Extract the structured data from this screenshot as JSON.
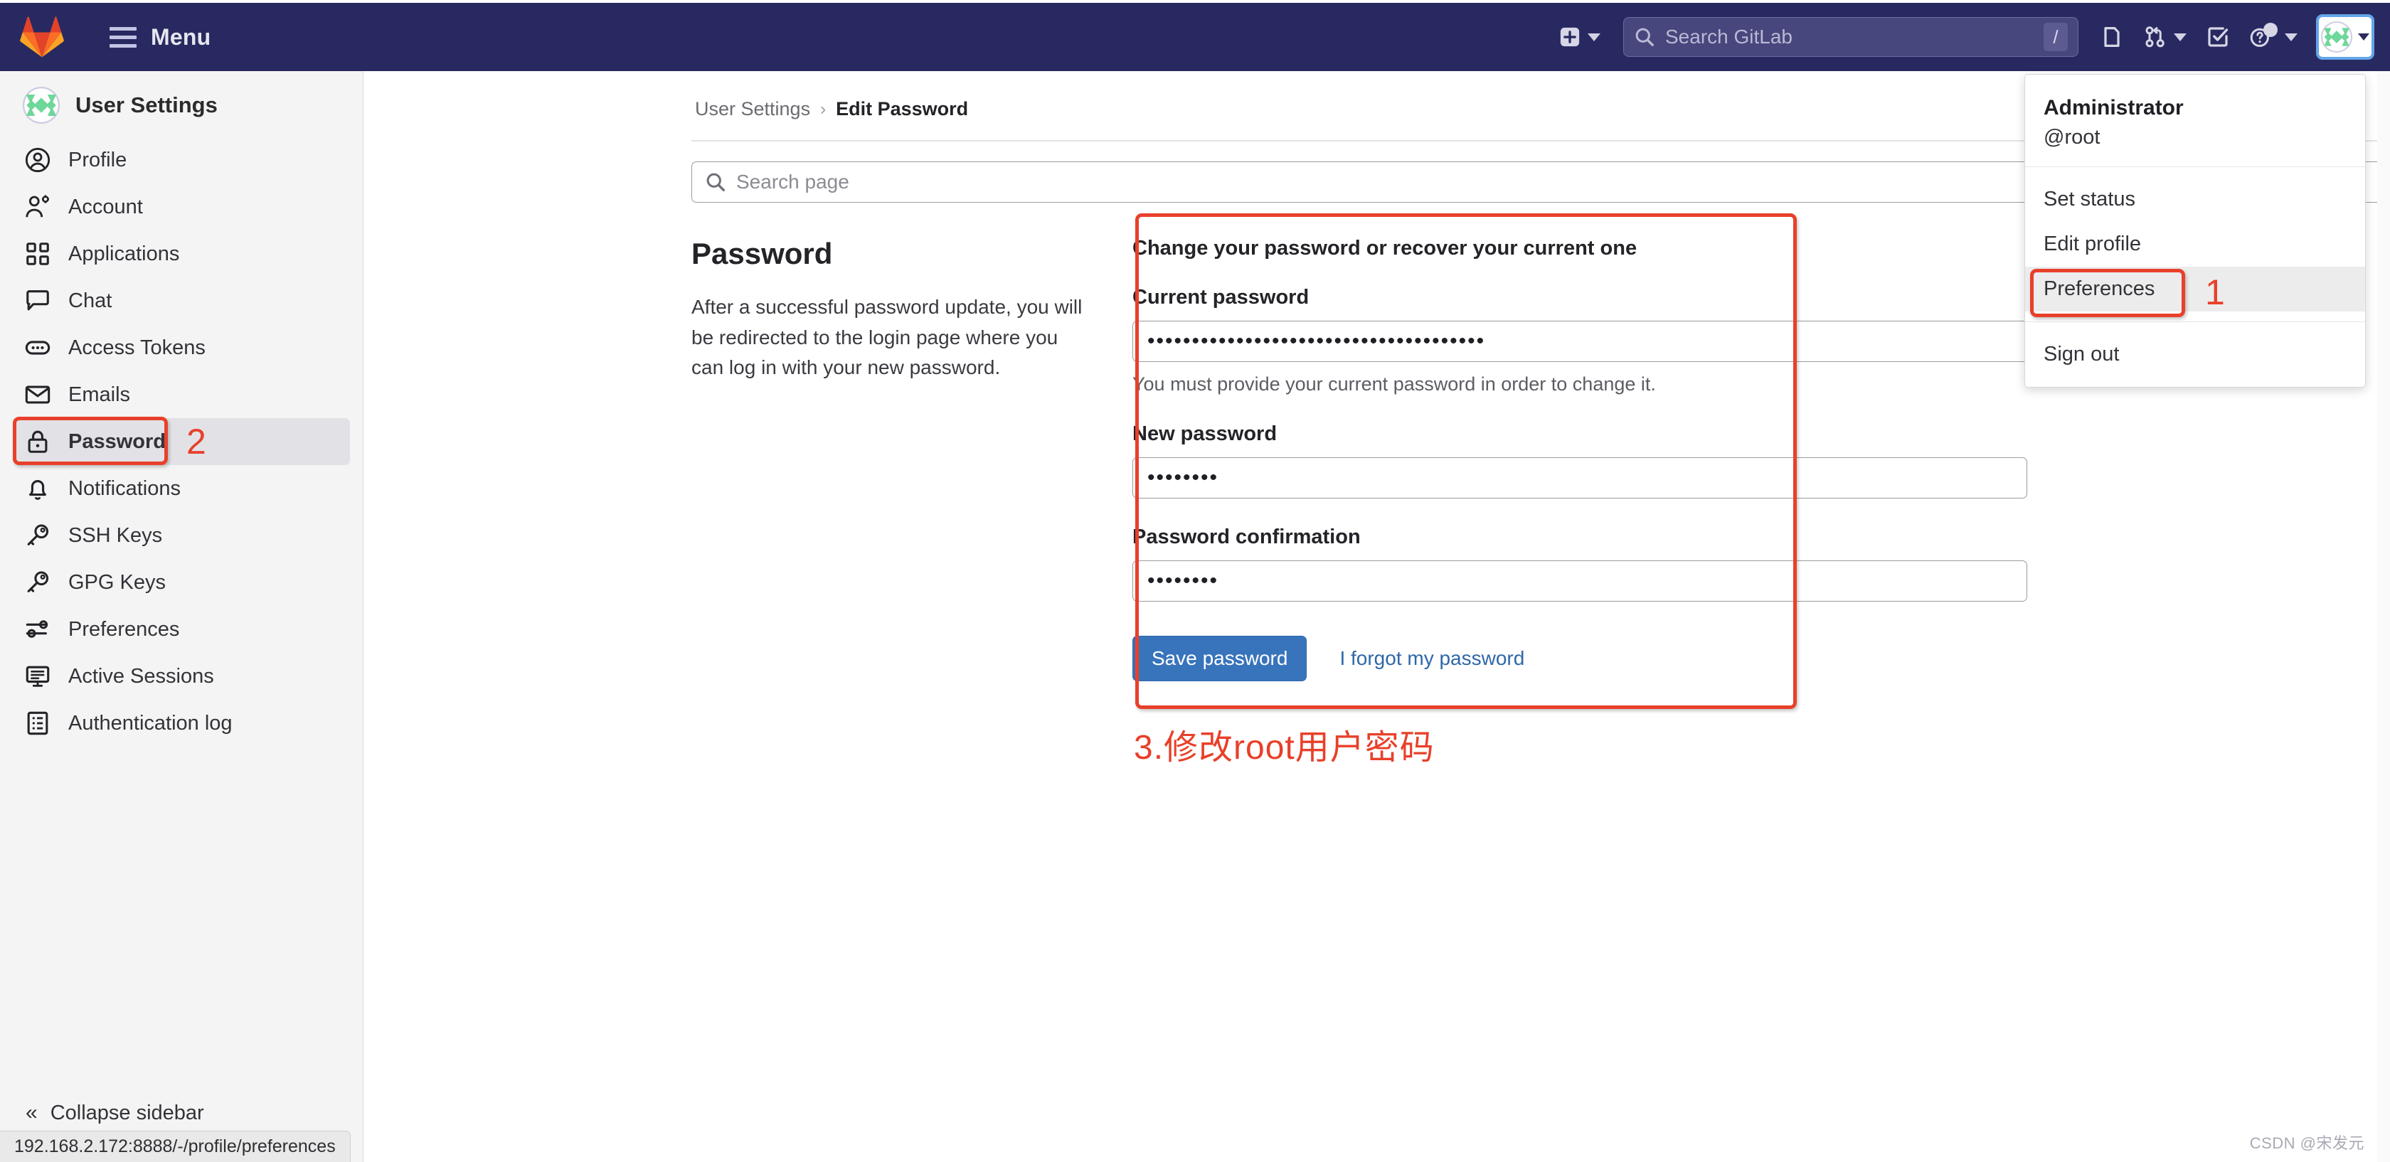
{
  "topbar": {
    "logo_icon": "gitlab-tanuki-logo",
    "menu_label": "Menu",
    "create_new_icon": "plus-square-icon",
    "search_placeholder": "Search GitLab",
    "search_shortcut": "/",
    "issues_icon": "issues-icon",
    "merge_requests_icon": "merge-request-icon",
    "todos_icon": "todo-checkbox-icon",
    "help_icon": "question-circle-icon",
    "avatar_icon": "user-identicon-avatar"
  },
  "sidebar": {
    "title": "User Settings",
    "avatar_icon": "user-identicon-avatar",
    "items": [
      {
        "label": "Profile",
        "icon": "user-circle-icon",
        "active": false
      },
      {
        "label": "Account",
        "icon": "user-gear-icon",
        "active": false
      },
      {
        "label": "Applications",
        "icon": "apps-grid-icon",
        "active": false
      },
      {
        "label": "Chat",
        "icon": "comment-icon",
        "active": false
      },
      {
        "label": "Access Tokens",
        "icon": "token-ellipsis-icon",
        "active": false
      },
      {
        "label": "Emails",
        "icon": "envelope-icon",
        "active": false
      },
      {
        "label": "Password",
        "icon": "lock-icon",
        "active": true
      },
      {
        "label": "Notifications",
        "icon": "bell-icon",
        "active": false
      },
      {
        "label": "SSH Keys",
        "icon": "key-icon",
        "active": false
      },
      {
        "label": "GPG Keys",
        "icon": "key-icon",
        "active": false
      },
      {
        "label": "Preferences",
        "icon": "sliders-icon",
        "active": false
      },
      {
        "label": "Active Sessions",
        "icon": "monitor-icon",
        "active": false
      },
      {
        "label": "Authentication log",
        "icon": "list-grid-icon",
        "active": false
      }
    ],
    "collapse_label": "Collapse sidebar",
    "collapse_icon": "chevron-double-left-icon"
  },
  "breadcrumb": {
    "parent": "User Settings",
    "separator": "›",
    "current": "Edit Password"
  },
  "page_search": {
    "placeholder": "Search page",
    "icon": "search-icon"
  },
  "section": {
    "title": "Password",
    "description": "After a successful password update, you will be redirected to the login page where you can log in with your new password."
  },
  "form": {
    "heading": "Change your password or recover your current one",
    "current_password_label": "Current password",
    "current_password_value": "••••••••••••••••••••••••••••••••••••••",
    "current_password_help": "You must provide your current password in order to change it.",
    "new_password_label": "New password",
    "new_password_value": "••••••••",
    "confirm_password_label": "Password confirmation",
    "confirm_password_value": "••••••••",
    "save_label": "Save password",
    "forgot_label": "I forgot my password"
  },
  "user_menu": {
    "name": "Administrator",
    "handle": "@root",
    "items": [
      {
        "label": "Set status",
        "highlighted": false
      },
      {
        "label": "Edit profile",
        "highlighted": false
      },
      {
        "label": "Preferences",
        "highlighted": true
      },
      {
        "label": "Sign out",
        "highlighted": false
      }
    ]
  },
  "annotations": {
    "marker_1": "1",
    "marker_2": "2",
    "caption_3": "3.修改root用户密码"
  },
  "statusbar": {
    "url": "192.168.2.172:8888/-/profile/preferences"
  },
  "watermark": "CSDN @宋发元",
  "colors": {
    "topbar_bg": "#292961",
    "accent_blue": "#3874bb",
    "annotation_red": "#e8402a",
    "sidebar_bg": "#f4f4f4",
    "active_item_bg": "#e2e2e6"
  }
}
